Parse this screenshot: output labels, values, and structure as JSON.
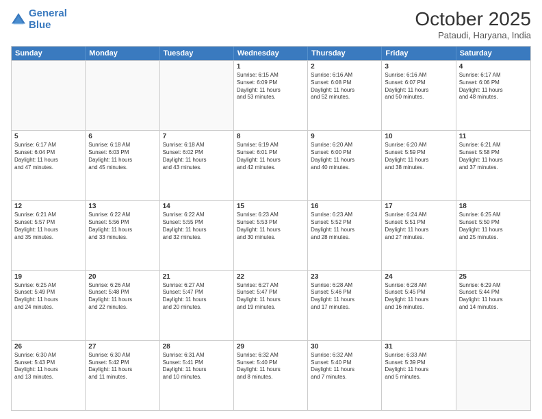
{
  "header": {
    "logo_line1": "General",
    "logo_line2": "Blue",
    "month": "October 2025",
    "location": "Pataudi, Haryana, India"
  },
  "weekdays": [
    "Sunday",
    "Monday",
    "Tuesday",
    "Wednesday",
    "Thursday",
    "Friday",
    "Saturday"
  ],
  "weeks": [
    [
      {
        "day": "",
        "text": ""
      },
      {
        "day": "",
        "text": ""
      },
      {
        "day": "",
        "text": ""
      },
      {
        "day": "1",
        "text": "Sunrise: 6:15 AM\nSunset: 6:09 PM\nDaylight: 11 hours\nand 53 minutes."
      },
      {
        "day": "2",
        "text": "Sunrise: 6:16 AM\nSunset: 6:08 PM\nDaylight: 11 hours\nand 52 minutes."
      },
      {
        "day": "3",
        "text": "Sunrise: 6:16 AM\nSunset: 6:07 PM\nDaylight: 11 hours\nand 50 minutes."
      },
      {
        "day": "4",
        "text": "Sunrise: 6:17 AM\nSunset: 6:06 PM\nDaylight: 11 hours\nand 48 minutes."
      }
    ],
    [
      {
        "day": "5",
        "text": "Sunrise: 6:17 AM\nSunset: 6:04 PM\nDaylight: 11 hours\nand 47 minutes."
      },
      {
        "day": "6",
        "text": "Sunrise: 6:18 AM\nSunset: 6:03 PM\nDaylight: 11 hours\nand 45 minutes."
      },
      {
        "day": "7",
        "text": "Sunrise: 6:18 AM\nSunset: 6:02 PM\nDaylight: 11 hours\nand 43 minutes."
      },
      {
        "day": "8",
        "text": "Sunrise: 6:19 AM\nSunset: 6:01 PM\nDaylight: 11 hours\nand 42 minutes."
      },
      {
        "day": "9",
        "text": "Sunrise: 6:20 AM\nSunset: 6:00 PM\nDaylight: 11 hours\nand 40 minutes."
      },
      {
        "day": "10",
        "text": "Sunrise: 6:20 AM\nSunset: 5:59 PM\nDaylight: 11 hours\nand 38 minutes."
      },
      {
        "day": "11",
        "text": "Sunrise: 6:21 AM\nSunset: 5:58 PM\nDaylight: 11 hours\nand 37 minutes."
      }
    ],
    [
      {
        "day": "12",
        "text": "Sunrise: 6:21 AM\nSunset: 5:57 PM\nDaylight: 11 hours\nand 35 minutes."
      },
      {
        "day": "13",
        "text": "Sunrise: 6:22 AM\nSunset: 5:56 PM\nDaylight: 11 hours\nand 33 minutes."
      },
      {
        "day": "14",
        "text": "Sunrise: 6:22 AM\nSunset: 5:55 PM\nDaylight: 11 hours\nand 32 minutes."
      },
      {
        "day": "15",
        "text": "Sunrise: 6:23 AM\nSunset: 5:53 PM\nDaylight: 11 hours\nand 30 minutes."
      },
      {
        "day": "16",
        "text": "Sunrise: 6:23 AM\nSunset: 5:52 PM\nDaylight: 11 hours\nand 28 minutes."
      },
      {
        "day": "17",
        "text": "Sunrise: 6:24 AM\nSunset: 5:51 PM\nDaylight: 11 hours\nand 27 minutes."
      },
      {
        "day": "18",
        "text": "Sunrise: 6:25 AM\nSunset: 5:50 PM\nDaylight: 11 hours\nand 25 minutes."
      }
    ],
    [
      {
        "day": "19",
        "text": "Sunrise: 6:25 AM\nSunset: 5:49 PM\nDaylight: 11 hours\nand 24 minutes."
      },
      {
        "day": "20",
        "text": "Sunrise: 6:26 AM\nSunset: 5:48 PM\nDaylight: 11 hours\nand 22 minutes."
      },
      {
        "day": "21",
        "text": "Sunrise: 6:27 AM\nSunset: 5:47 PM\nDaylight: 11 hours\nand 20 minutes."
      },
      {
        "day": "22",
        "text": "Sunrise: 6:27 AM\nSunset: 5:47 PM\nDaylight: 11 hours\nand 19 minutes."
      },
      {
        "day": "23",
        "text": "Sunrise: 6:28 AM\nSunset: 5:46 PM\nDaylight: 11 hours\nand 17 minutes."
      },
      {
        "day": "24",
        "text": "Sunrise: 6:28 AM\nSunset: 5:45 PM\nDaylight: 11 hours\nand 16 minutes."
      },
      {
        "day": "25",
        "text": "Sunrise: 6:29 AM\nSunset: 5:44 PM\nDaylight: 11 hours\nand 14 minutes."
      }
    ],
    [
      {
        "day": "26",
        "text": "Sunrise: 6:30 AM\nSunset: 5:43 PM\nDaylight: 11 hours\nand 13 minutes."
      },
      {
        "day": "27",
        "text": "Sunrise: 6:30 AM\nSunset: 5:42 PM\nDaylight: 11 hours\nand 11 minutes."
      },
      {
        "day": "28",
        "text": "Sunrise: 6:31 AM\nSunset: 5:41 PM\nDaylight: 11 hours\nand 10 minutes."
      },
      {
        "day": "29",
        "text": "Sunrise: 6:32 AM\nSunset: 5:40 PM\nDaylight: 11 hours\nand 8 minutes."
      },
      {
        "day": "30",
        "text": "Sunrise: 6:32 AM\nSunset: 5:40 PM\nDaylight: 11 hours\nand 7 minutes."
      },
      {
        "day": "31",
        "text": "Sunrise: 6:33 AM\nSunset: 5:39 PM\nDaylight: 11 hours\nand 5 minutes."
      },
      {
        "day": "",
        "text": ""
      }
    ]
  ]
}
